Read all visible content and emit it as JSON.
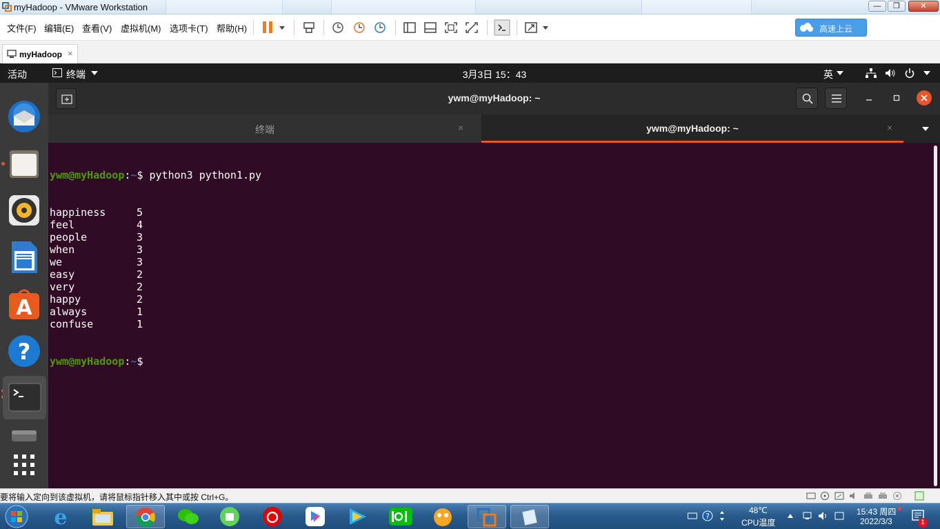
{
  "window": {
    "title": "myHadoop - VMware Workstation",
    "buttons": [
      "—",
      "❐",
      "✕"
    ]
  },
  "menu": [
    "文件(F)",
    "编辑(E)",
    "查看(V)",
    "虚拟机(M)",
    "选项卡(T)",
    "帮助(H)"
  ],
  "toolbar": {
    "accent": "#f07b1d",
    "cloud_button_label": "高速上云"
  },
  "vm_tab": {
    "label": "myHadoop",
    "close": "×"
  },
  "gnome_panel": {
    "activities": "活动",
    "app_menu": "终端",
    "clock": "3月3日  15：43",
    "input_method": "英"
  },
  "dock": {
    "items": [
      "thunderbird-icon",
      "files-icon",
      "rhythmbox-icon",
      "libreoffice-writer-icon",
      "ubuntu-software-icon",
      "help-icon",
      "terminal-icon",
      "drive-icon",
      "show-apps-icon"
    ]
  },
  "terminal": {
    "title": "ywm@myHadoop: ~",
    "tabs": [
      {
        "label": "终端",
        "close": "×"
      },
      {
        "label": "ywm@myHadoop: ~",
        "close": "×"
      }
    ],
    "prompt_user": "ywm@myHadoop",
    "prompt_sep": ":",
    "prompt_path": "~",
    "prompt_end": "$ ",
    "command": "python3 python1.py",
    "output": [
      {
        "word": "happiness",
        "count": "5"
      },
      {
        "word": "feel",
        "count": "4"
      },
      {
        "word": "people",
        "count": "3"
      },
      {
        "word": "when",
        "count": "3"
      },
      {
        "word": "we",
        "count": "3"
      },
      {
        "word": "easy",
        "count": "2"
      },
      {
        "word": "very",
        "count": "2"
      },
      {
        "word": "happy",
        "count": "2"
      },
      {
        "word": "always",
        "count": "1"
      },
      {
        "word": "confuse",
        "count": "1"
      }
    ],
    "colors": {
      "background": "#300a24",
      "prompt_user": "#4e9a06",
      "prompt_path": "#3465a4",
      "accent": "#e9542a"
    }
  },
  "statusbar": {
    "message": "要将输入定向到该虚拟机，请将鼠标指针移入其中或按 Ctrl+G。"
  },
  "taskbar": {
    "apps": [
      "start-orb-icon",
      "ie-icon",
      "explorer-icon",
      "chrome-icon",
      "wechat-icon",
      "app-icon",
      "netease-music-icon",
      "youku-icon",
      "video-icon",
      "iqiyi-icon",
      "app-icon",
      "vmware-icon",
      "notepad-icon"
    ],
    "temperature": "48℃",
    "temperature_label": "CPU温度",
    "time": "15:43 周四",
    "date": "2022/3/3",
    "notification_count": "1"
  }
}
